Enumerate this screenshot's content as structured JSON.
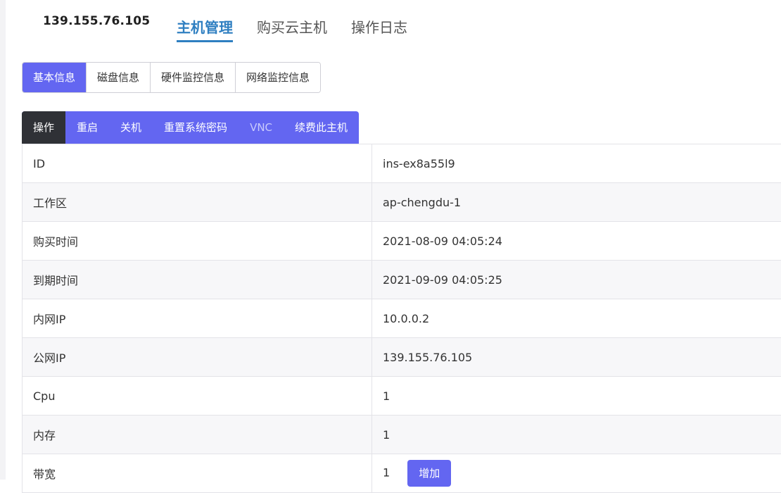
{
  "header": {
    "host_ip": "139.155.76.105",
    "nav": [
      {
        "label": "主机管理",
        "active": true
      },
      {
        "label": "购买云主机",
        "active": false
      },
      {
        "label": "操作日志",
        "active": false
      }
    ]
  },
  "tabs": [
    "基本信息",
    "磁盘信息",
    "硬件监控信息",
    "网络监控信息"
  ],
  "actions": {
    "label": "操作",
    "buttons": [
      "重启",
      "关机",
      "重置系统密码",
      "VNC",
      "续费此主机"
    ]
  },
  "info_rows": [
    {
      "key": "ID",
      "value": "ins-ex8a55l9"
    },
    {
      "key": "工作区",
      "value": "ap-chengdu-1"
    },
    {
      "key": "购买时间",
      "value": "2021-08-09 04:05:24"
    },
    {
      "key": "到期时间",
      "value": "2021-09-09 04:05:25"
    },
    {
      "key": "内网IP",
      "value": "10.0.0.2"
    },
    {
      "key": "公网IP",
      "value": "139.155.76.105"
    },
    {
      "key": "Cpu",
      "value": "1"
    },
    {
      "key": "内存",
      "value": "1"
    },
    {
      "key": "带宽",
      "value": "1",
      "button": "增加"
    }
  ],
  "colors": {
    "accent": "#6366f1",
    "nav_active": "#2f7fc1",
    "action_label_bg": "#2f3136"
  }
}
